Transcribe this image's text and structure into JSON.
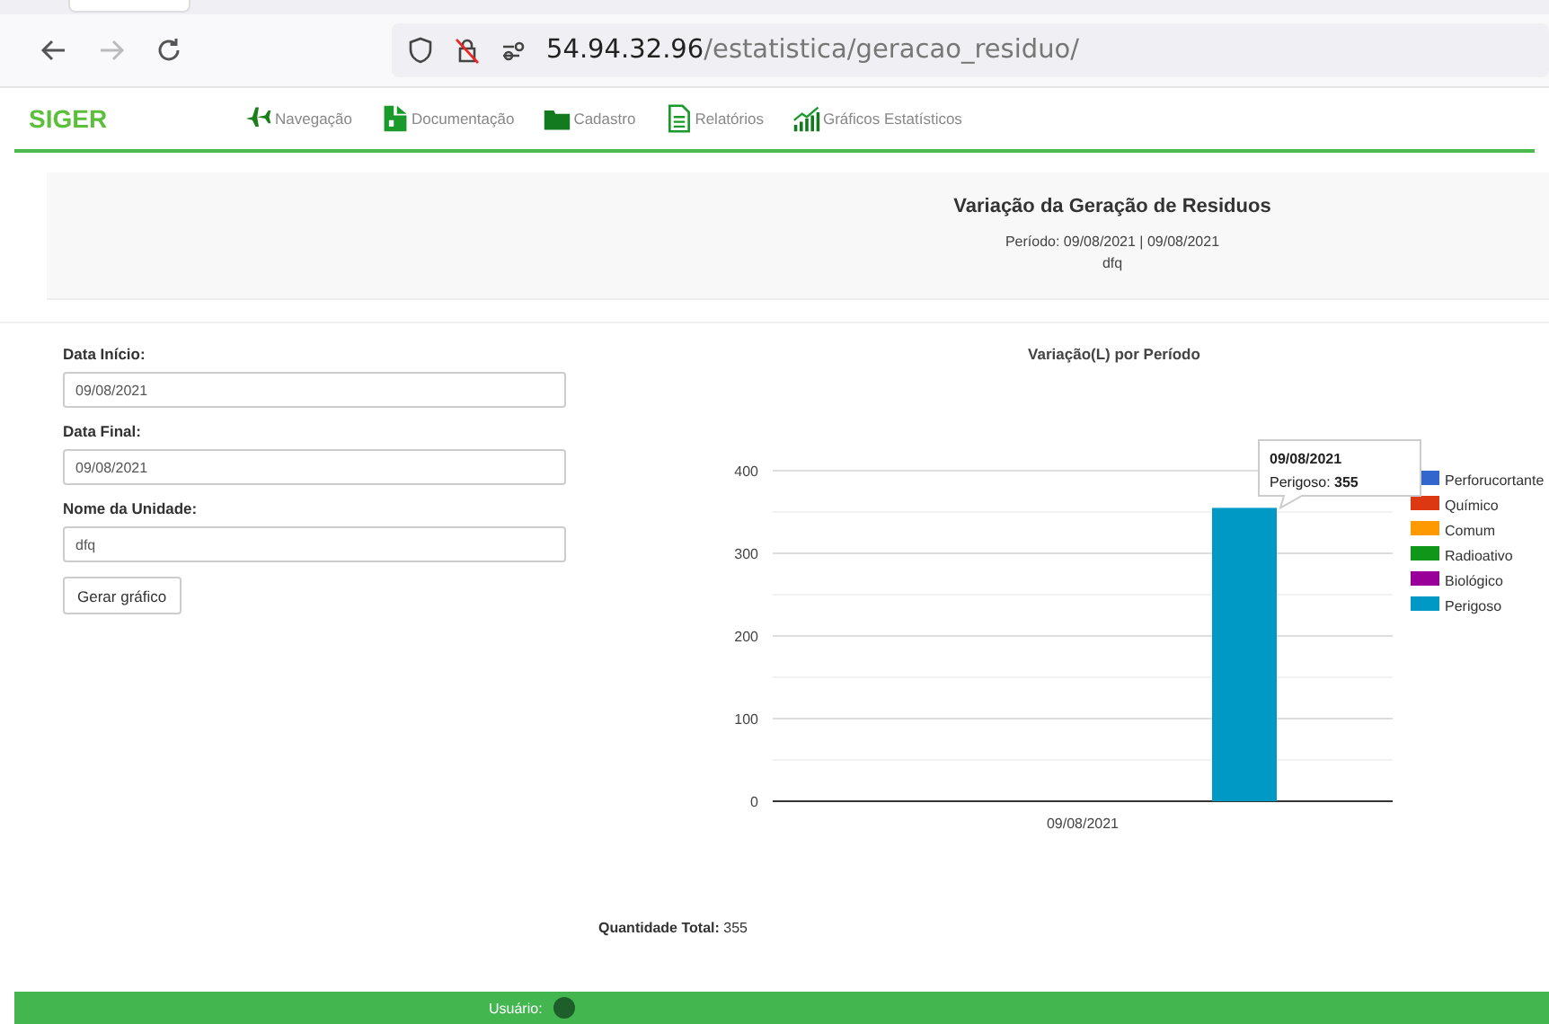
{
  "browser": {
    "url_host": "54.94.32.96",
    "url_path": "/estatistica/geracao_residuo/",
    "forward_disabled": true
  },
  "nav": {
    "logo": "SIGER",
    "items": [
      {
        "label": "Navegação",
        "kind": "plane"
      },
      {
        "label": "Documentação",
        "kind": "document"
      },
      {
        "label": "Cadastro",
        "kind": "folder"
      },
      {
        "label": "Relatórios",
        "kind": "report"
      },
      {
        "label": "Gráficos Estatísticos",
        "kind": "chart"
      }
    ]
  },
  "header": {
    "title": "Variação da Geração de Residuos",
    "period": "Período: 09/08/2021 | 09/08/2021",
    "unit": "dfq"
  },
  "form": {
    "fields": [
      {
        "label": "Data Início:",
        "value": "09/08/2021"
      },
      {
        "label": "Data Final:",
        "value": "09/08/2021"
      },
      {
        "label": "Nome da Unidade:",
        "value": "dfq"
      }
    ],
    "button": "Gerar gráfico"
  },
  "chart": {
    "chart_data": {
      "type": "bar",
      "title": "Variação(L) por Período",
      "categories": [
        "09/08/2021"
      ],
      "ylim": [
        0,
        400
      ],
      "grid": true,
      "yticks": [
        0,
        100,
        200,
        300,
        400
      ],
      "series": [
        {
          "name": "Perforucortante",
          "color": "#3366cc",
          "values": [
            0
          ]
        },
        {
          "name": "Químico",
          "color": "#dc3912",
          "values": [
            0
          ]
        },
        {
          "name": "Comum",
          "color": "#ff9900",
          "values": [
            0
          ]
        },
        {
          "name": "Radioativo",
          "color": "#109618",
          "values": [
            0
          ]
        },
        {
          "name": "Biológico",
          "color": "#990099",
          "values": [
            0
          ]
        },
        {
          "name": "Perigoso",
          "color": "#0099c6",
          "values": [
            355
          ]
        }
      ]
    },
    "tooltip": {
      "title": "09/08/2021",
      "label": "Perigoso:",
      "value": "355"
    }
  },
  "total": {
    "label": "Quantidade Total:",
    "value": "355"
  },
  "footer": {
    "user_label": "Usuário:"
  }
}
